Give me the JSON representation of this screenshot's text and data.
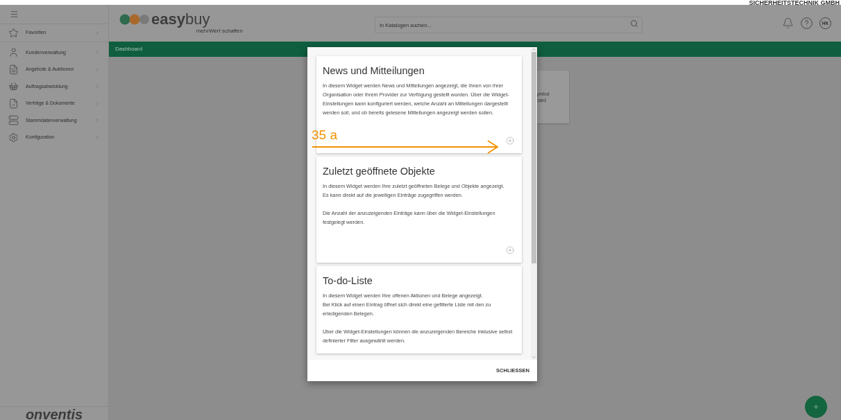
{
  "top_strip": {
    "company": "SICHERHEITSTECHNIK GMBH"
  },
  "sidebar": {
    "items": [
      {
        "label": "Favoriten"
      },
      {
        "label": "Kundenverwaltung"
      },
      {
        "label": "Angebote & Auktionen"
      },
      {
        "label": "Auftragsabwicklung"
      },
      {
        "label": "Verträge & Dokumente"
      },
      {
        "label": "Stammdatenverwaltung"
      },
      {
        "label": "Konfiguration"
      }
    ],
    "footer_logo": "onventis"
  },
  "header": {
    "logo": "**easy**buy",
    "tagline": "mehrWert schaffen",
    "search": {
      "placeholder": "In Katalogen suchen..."
    },
    "user_initials": "HK"
  },
  "breadcrumb": "Dashboard",
  "background_card": {
    "lines": [
      "ymbol",
      "oard"
    ]
  },
  "dialog": {
    "widgets": [
      {
        "title": "News und Mitteilungen",
        "paragraphs": [
          [
            "In diesem Widget werden News und Mitteilungen angezeigt, die Ihnen von Ihrer Organisation oder Ihrem Provider zur Verfügung gestellt wurden. Über die Widget-Einstellungen kann konfiguriert werden, welche Anzahl an Mitteilungen dargestellt werden soll, und ob bereits gelesene Mitteilungen angezeigt werden sollen."
          ]
        ],
        "add_button": true
      },
      {
        "title": "Zuletzt geöffnete Objekte",
        "paragraphs": [
          [
            "In diesem Widget werden Ihre zuletzt geöffneten Belege und Objekte angezeigt.",
            "Es kann direkt auf die jeweiligen Einträge zugegriffen werden."
          ],
          [
            "Die Anzahl der anzuzeigenden Einträge kann über die Widget-Einstellungen festgelegt werden."
          ]
        ],
        "add_button": true
      },
      {
        "title": "To-do-Liste",
        "paragraphs": [
          [
            "In diesem Widget werden Ihre offenen Aktionen und Belege angezeigt.",
            "Bei Klick auf einen Eintrag öffnet sich direkt eine gefilterte Liste mit den zu erledigenden Belegen."
          ],
          [
            "Über die Widget-Einstellungen können die anzuzeigenden Bereiche inklusive selbst definierter Filter ausgewählt werden."
          ]
        ],
        "add_button": false
      }
    ],
    "close": "SCHLIESSEN"
  },
  "annotation": {
    "label": "35 a"
  }
}
